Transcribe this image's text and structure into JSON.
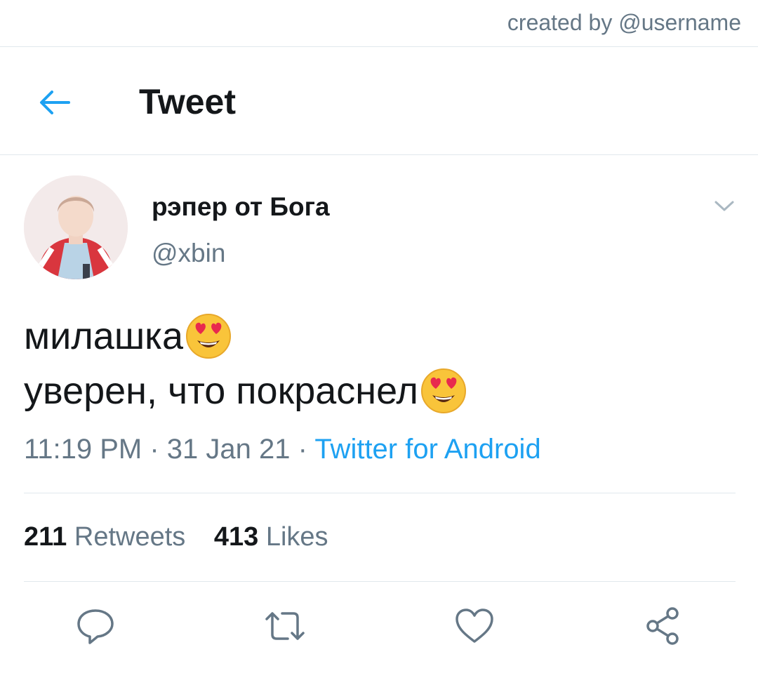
{
  "credit": "created by @username",
  "header": {
    "title": "Tweet"
  },
  "author": {
    "name": "рэпер от Бога",
    "handle": "@xbin"
  },
  "tweet": {
    "lines": [
      "милашка",
      "уверен, что покраснел"
    ],
    "emoji": "smiling-face-with-heart-eyes"
  },
  "meta": {
    "time": "11:19 PM",
    "sep1": " · ",
    "date": "31 Jan 21",
    "sep2": " · ",
    "source": "Twitter for Android"
  },
  "stats": {
    "retweets": {
      "count": "211",
      "label": "Retweets"
    },
    "likes": {
      "count": "413",
      "label": "Likes"
    }
  },
  "icons": {
    "back": "arrow-left-icon",
    "caret": "chevron-down-icon",
    "reply": "reply-icon",
    "retweet": "retweet-icon",
    "like": "heart-icon",
    "share": "share-icon"
  },
  "colors": {
    "accent": "#1da1f2",
    "secondary_text": "#657786",
    "border": "#e1e8ed"
  }
}
